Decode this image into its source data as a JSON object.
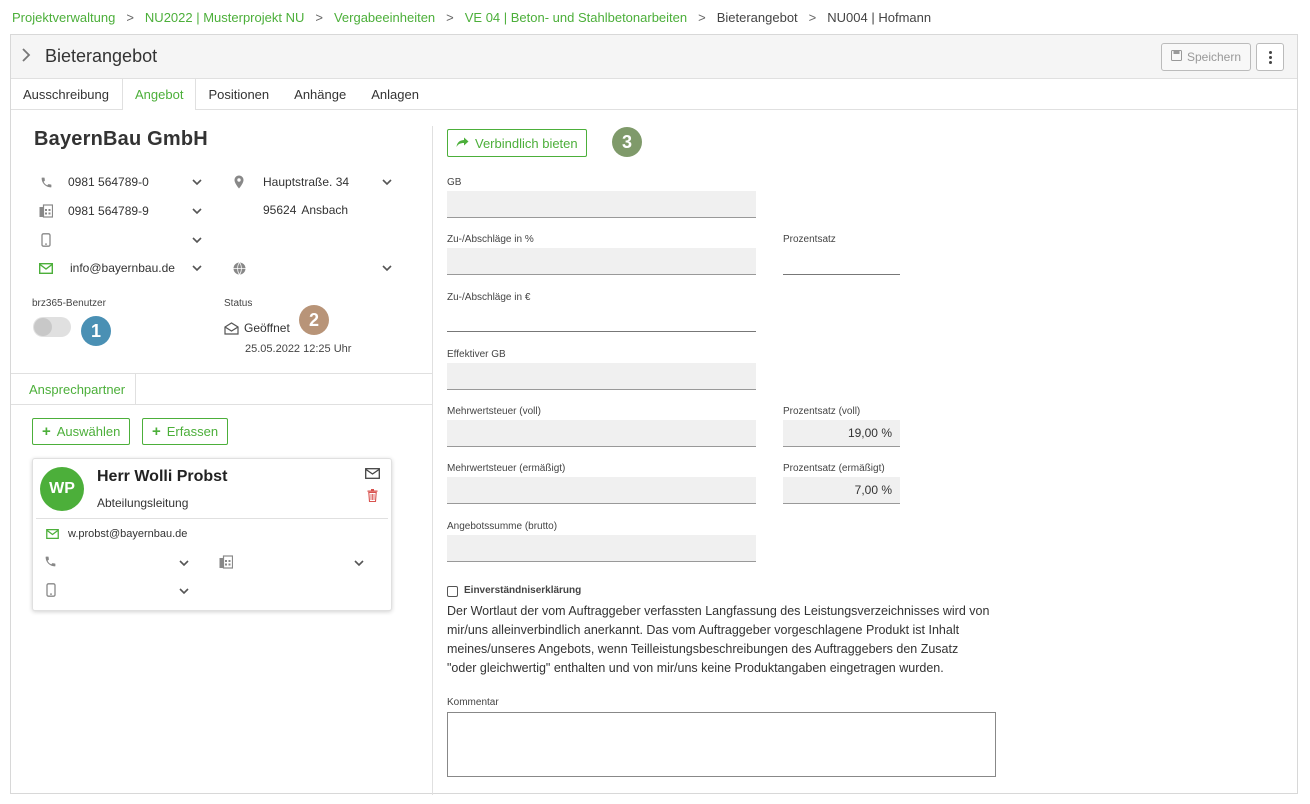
{
  "breadcrumb": {
    "items": [
      "Projektverwaltung",
      "NU2022 | Musterprojekt NU",
      "Vergabeeinheiten",
      "VE 04 | Beton- und Stahlbetonarbeiten",
      "Bieterangebot",
      "NU004 | Hofmann"
    ],
    "separator": ">"
  },
  "header": {
    "title": "Bieterangebot",
    "save_label": "Speichern"
  },
  "tabs": [
    {
      "label": "Ausschreibung",
      "active": false
    },
    {
      "label": "Angebot",
      "active": true
    },
    {
      "label": "Positionen",
      "active": false
    },
    {
      "label": "Anhänge",
      "active": false
    },
    {
      "label": "Anlagen",
      "active": false
    }
  ],
  "company": {
    "name": "BayernBau GmbH",
    "phone": "0981 564789-0",
    "fax": "0981 564789-9",
    "mobile": "",
    "email": "info@bayernbau.de",
    "street": "Hauptstraße. 34",
    "zip": "95624",
    "city": "Ansbach",
    "website": ""
  },
  "brz_user": {
    "label": "brz365-Benutzer",
    "enabled": false,
    "badge": "1"
  },
  "status": {
    "label": "Status",
    "value": "Geöffnet",
    "date": "25.05.2022 12:25 Uhr",
    "badge": "2"
  },
  "contacts": {
    "tab_label": "Ansprechpartner",
    "select_label": "Auswählen",
    "add_label": "Erfassen",
    "person": {
      "initials": "WP",
      "name": "Herr Wolli Probst",
      "role": "Abteilungsleitung",
      "email": "w.probst@bayernbau.de"
    }
  },
  "offer": {
    "bid_button": "Verbindlich bieten",
    "badge": "3",
    "fields": {
      "gb": {
        "label": "GB",
        "value": ""
      },
      "surcharge_percent": {
        "label": "Zu-/Abschläge in %",
        "value": ""
      },
      "percent_rate": {
        "label": "Prozentsatz",
        "value": ""
      },
      "surcharge_euro": {
        "label": "Zu-/Abschläge in €",
        "value": ""
      },
      "effective_gb": {
        "label": "Effektiver GB",
        "value": ""
      },
      "vat_full": {
        "label": "Mehrwertsteuer (voll)",
        "value": ""
      },
      "vat_full_rate": {
        "label": "Prozentsatz (voll)",
        "value": "19,00 %"
      },
      "vat_reduced": {
        "label": "Mehrwertsteuer (ermäßigt)",
        "value": ""
      },
      "vat_reduced_rate": {
        "label": "Prozentsatz (ermäßigt)",
        "value": "7,00 %"
      },
      "total_gross": {
        "label": "Angebotssumme (brutto)",
        "value": ""
      }
    },
    "consent": {
      "label": "Einverständniserklärung",
      "checked": false,
      "text_lines": [
        "Der Wortlaut der vom Auftraggeber verfassten Langfassung des Leistungsverzeichnisses wird von",
        "mir/uns alleinverbindlich anerkannt. Das vom Auftraggeber vorgeschlagene Produkt ist Inhalt",
        "meines/unseres Angebots, wenn Teilleistungsbeschreibungen des Auftraggebers den Zusatz",
        "\"oder gleichwertig\" enthalten und von mir/uns keine Produktangaben eingetragen wurden."
      ]
    },
    "comment": {
      "label": "Kommentar",
      "value": ""
    }
  },
  "colors": {
    "accent": "#4caf3a",
    "badge_1": "#4a90b4",
    "badge_2": "#b89478",
    "badge_3": "#7f9a6a",
    "delete": "#d9534f"
  },
  "icons": [
    "chevron-right-icon",
    "save-icon",
    "more-vertical-icon",
    "phone-icon",
    "fax-icon",
    "mobile-icon",
    "email-icon",
    "map-marker-icon",
    "globe-icon",
    "chevron-down-icon",
    "envelope-open-icon",
    "plus-icon",
    "trash-icon",
    "share-arrow-icon"
  ]
}
